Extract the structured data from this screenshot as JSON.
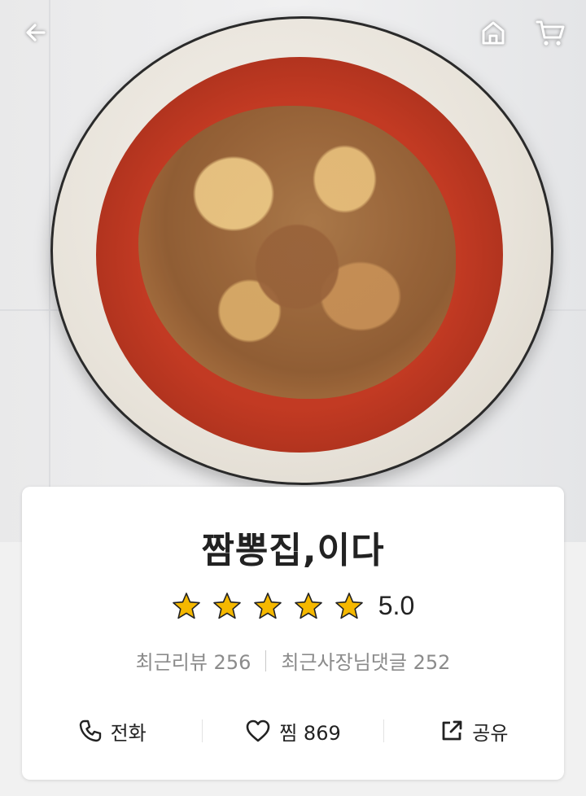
{
  "header": {
    "back_icon": "arrow-left-icon",
    "home_icon": "home-icon",
    "cart_icon": "cart-icon"
  },
  "hero": {
    "image_subject": "jjamppong-photo"
  },
  "store": {
    "name": "짬뽕집,이다",
    "rating": "5.0",
    "stars": 5,
    "star_color": "#f5b800",
    "recent_reviews_label": "최근리뷰 256",
    "recent_owner_replies_label": "최근사장님댓글 252"
  },
  "actions": {
    "call_label": "전화",
    "call_icon": "phone-icon",
    "favorite_label": "찜 869",
    "favorite_icon": "heart-outline-icon",
    "share_label": "공유",
    "share_icon": "share-icon"
  }
}
